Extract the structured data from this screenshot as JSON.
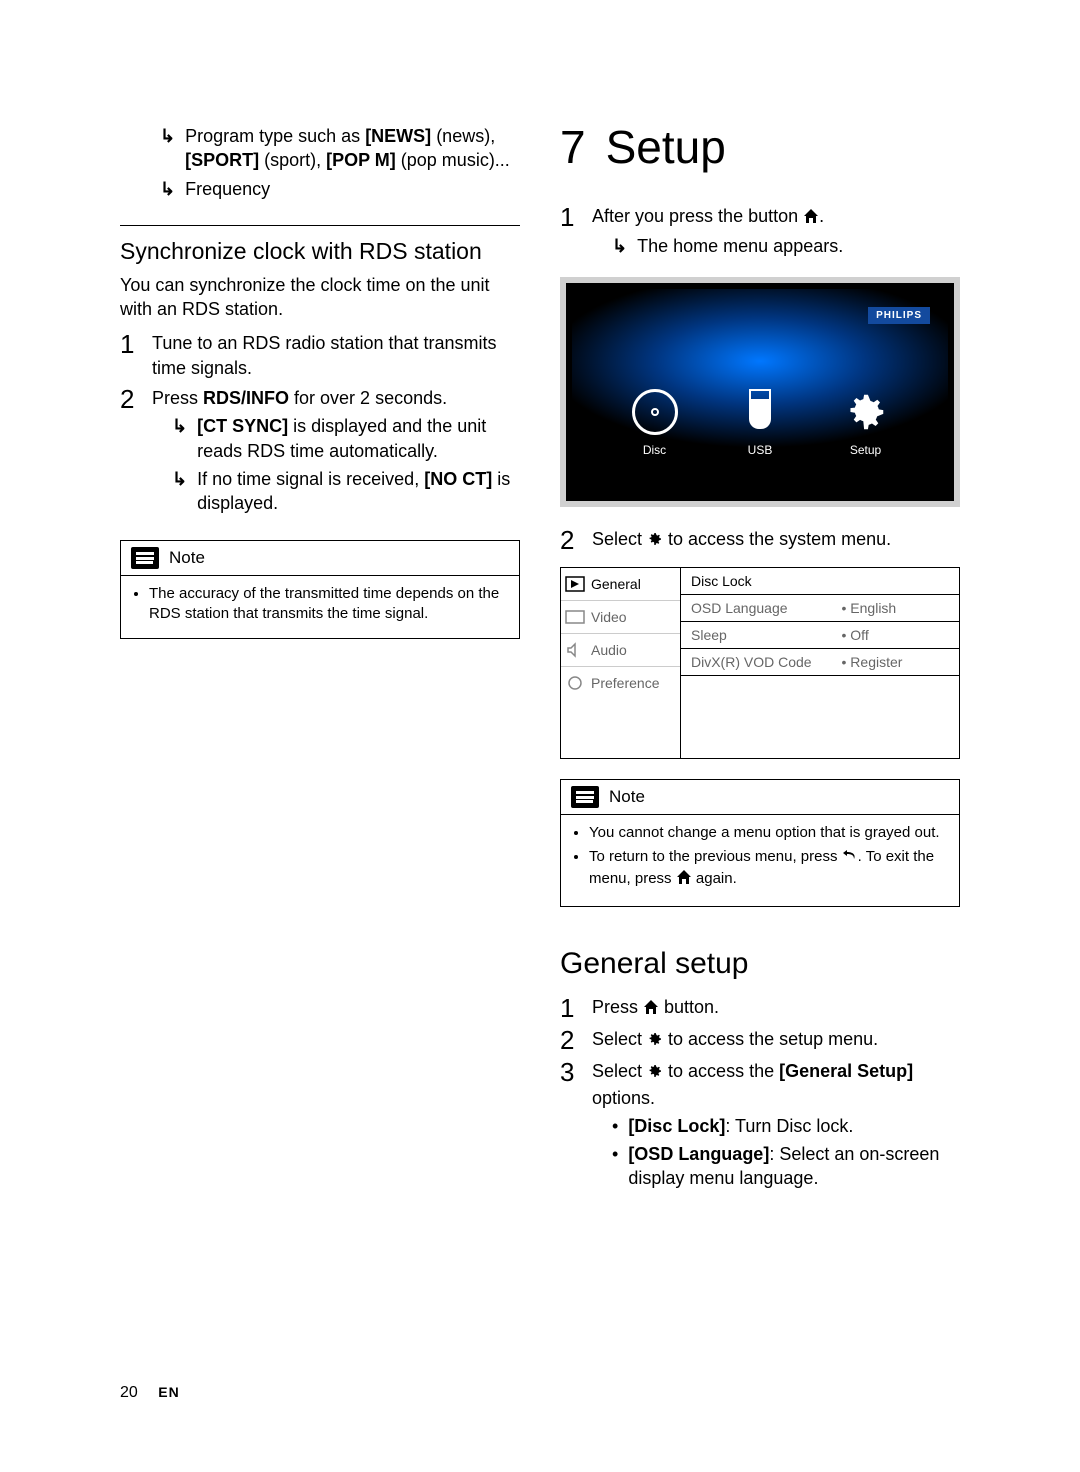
{
  "left": {
    "bullets": [
      {
        "prefix": "Program type such as ",
        "b1": "[NEWS]",
        "t1": " (news), ",
        "b2": "[SPORT]",
        "t2": " (sport), ",
        "b3": "[POP M]",
        "t3": " (pop music)..."
      },
      {
        "text": "Frequency"
      }
    ],
    "subhead": "Synchronize clock with RDS station",
    "intro": "You can synchronize the clock time on the unit with an RDS station.",
    "steps": [
      {
        "num": "1",
        "text": "Tune to an RDS radio station that transmits time signals."
      },
      {
        "num": "2",
        "lead": "Press ",
        "b": "RDS/INFO",
        "tail": " for over 2 seconds.",
        "subs": [
          {
            "b": "[CT SYNC]",
            "tail": " is displayed and the unit reads RDS time automatically."
          },
          {
            "lead": "If no time signal is received, ",
            "b": "[NO CT]",
            "tail": " is displayed."
          }
        ]
      }
    ],
    "note": {
      "label": "Note",
      "items": [
        "The accuracy of the transmitted time depends on the RDS station that transmits the time signal."
      ]
    }
  },
  "right": {
    "chapter_num": "7",
    "chapter_title": "Setup",
    "step1": {
      "num": "1",
      "lead": "After you press the button ",
      "tail": "."
    },
    "step1_sub": "The home menu appears.",
    "tv": {
      "brand": "PHILIPS",
      "items": [
        {
          "key": "disc",
          "label": "Disc"
        },
        {
          "key": "usb",
          "label": "USB"
        },
        {
          "key": "setup",
          "label": "Setup"
        }
      ]
    },
    "step2": {
      "num": "2",
      "lead": "Select ",
      "tail": " to access the system menu."
    },
    "menu": {
      "left": [
        "General",
        "Video",
        "Audio",
        "Preference"
      ],
      "right": [
        {
          "k": "Disc Lock",
          "v": ""
        },
        {
          "k": "OSD Language",
          "v": "English"
        },
        {
          "k": "Sleep",
          "v": "Off"
        },
        {
          "k": "DivX(R) VOD Code",
          "v": "Register"
        }
      ]
    },
    "note": {
      "label": "Note",
      "items": [
        "You cannot change a menu option that is grayed out.",
        {
          "a": "To return to the previous menu, press ",
          "b": ". To exit the menu, press ",
          "c": " again."
        }
      ]
    },
    "section": "General setup",
    "gs_steps": [
      {
        "num": "1",
        "lead": "Press ",
        "tail": " button."
      },
      {
        "num": "2",
        "lead": "Select ",
        "tail": " to access the setup menu."
      },
      {
        "num": "3",
        "lead": "Select ",
        "mid_b": "[General Setup]",
        "tail_a": " to access the ",
        "tail_b": " options."
      }
    ],
    "gs_bullets": [
      {
        "b": "[Disc Lock]",
        "t": ": Turn Disc lock."
      },
      {
        "b": "[OSD Language]",
        "t": ": Select an on-screen display menu language."
      }
    ]
  },
  "footer": {
    "page": "20",
    "lang": "EN"
  }
}
